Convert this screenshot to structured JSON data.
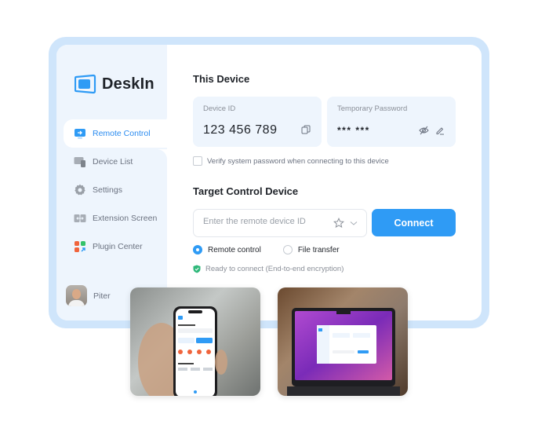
{
  "app": {
    "name": "DeskIn",
    "brand_color": "#2f9bf5"
  },
  "sidebar": {
    "items": [
      {
        "label": "Remote Control",
        "icon": "monitor-arrow-icon",
        "active": true
      },
      {
        "label": "Device List",
        "icon": "devices-icon",
        "active": false
      },
      {
        "label": "Settings",
        "icon": "gear-icon",
        "active": false
      },
      {
        "label": "Extension Screen",
        "icon": "extension-screen-icon",
        "active": false
      },
      {
        "label": "Plugin Center",
        "icon": "plugin-grid-icon",
        "active": false
      }
    ],
    "user": {
      "name": "Piter"
    }
  },
  "this_device": {
    "title": "This Device",
    "device_id_label": "Device ID",
    "device_id": "123 456 789",
    "temp_password_label": "Temporary Password",
    "temp_password": "*** ***",
    "verify_label": "Verify system password when connecting to this device",
    "verify_checked": false
  },
  "target": {
    "title": "Target Control Device",
    "input_placeholder": "Enter the remote device ID",
    "input_value": "",
    "connect_label": "Connect",
    "modes": [
      {
        "label": "Remote control",
        "selected": true
      },
      {
        "label": "File transfer",
        "selected": false
      }
    ],
    "status": "Ready to connect (End-to-end encryption)"
  },
  "photos": [
    {
      "name": "phone-app-photo",
      "description": "Hand holding phone running DeskIn app"
    },
    {
      "name": "laptop-app-photo",
      "description": "Laptop running DeskIn desktop app"
    }
  ]
}
